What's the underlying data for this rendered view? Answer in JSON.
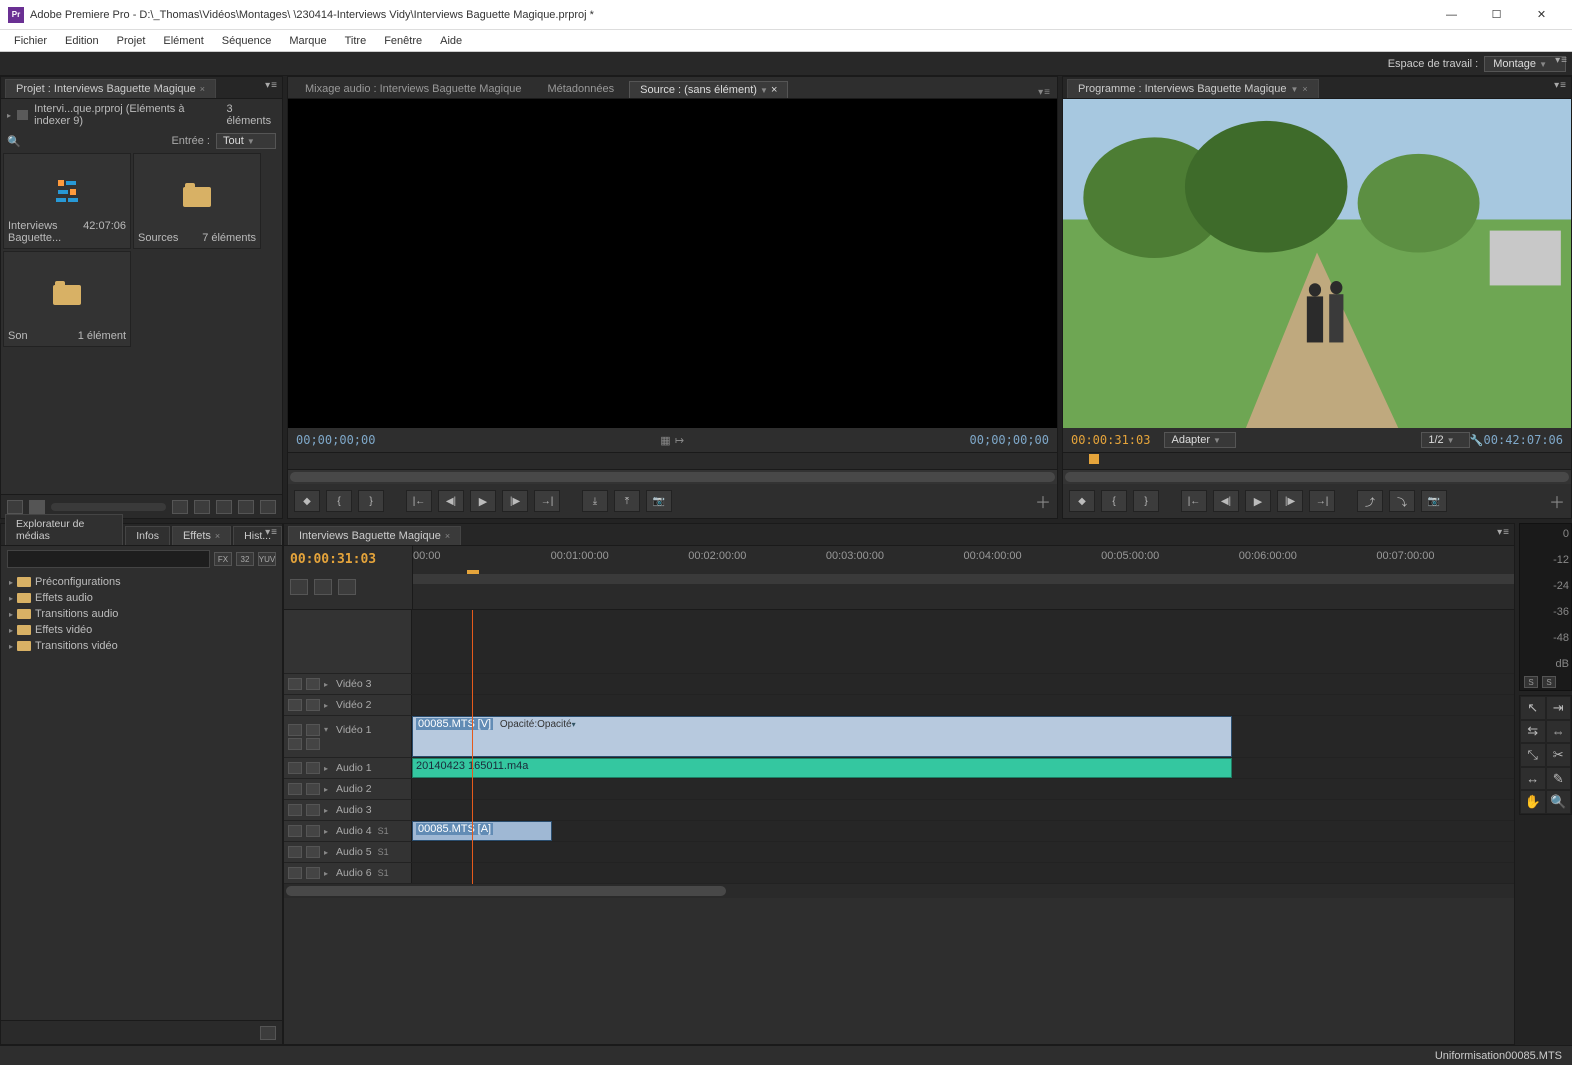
{
  "titlebar": {
    "app_badge": "Pr",
    "title": "Adobe Premiere Pro - D:\\_Thomas\\Vidéos\\Montages\\                       \\230414-Interviews Vidy\\Interviews Baguette Magique.prproj *"
  },
  "menubar": [
    "Fichier",
    "Edition",
    "Projet",
    "Elément",
    "Séquence",
    "Marque",
    "Titre",
    "Fenêtre",
    "Aide"
  ],
  "workspace": {
    "label": "Espace de travail :",
    "value": "Montage"
  },
  "project": {
    "tab": "Projet : Interviews Baguette Magique",
    "path": "Intervi...que.prproj (Eléments à indexer 9)",
    "count": "3 éléments",
    "entry_label": "Entrée :",
    "entry_value": "Tout",
    "items": [
      {
        "name": "Interviews Baguette...",
        "right": "42:07:06",
        "kind": "sequence"
      },
      {
        "name": "Sources",
        "right": "7 éléments",
        "kind": "bin"
      },
      {
        "name": "Son",
        "right": "1 élément",
        "kind": "bin"
      }
    ]
  },
  "source": {
    "tabs": {
      "mix": "Mixage audio : Interviews Baguette Magique",
      "meta": "Métadonnées",
      "src": "Source : (sans élément)"
    },
    "tc_left": "00;00;00;00",
    "tc_right": "00;00;00;00"
  },
  "program": {
    "tab": "Programme : Interviews Baguette Magique",
    "tc_left": "00:00:31:03",
    "fit": "Adapter",
    "ratio": "1/2",
    "tc_right": "00:42:07:06"
  },
  "effects": {
    "tabs": [
      "Explorateur de médias",
      "Infos",
      "Effets",
      "Hist..."
    ],
    "active_index": 2,
    "search_placeholder": "",
    "badges": [
      "FX",
      "32",
      "YUV"
    ],
    "nodes": [
      "Préconfigurations",
      "Effets audio",
      "Transitions audio",
      "Effets vidéo",
      "Transitions vidéo"
    ]
  },
  "timeline": {
    "tab": "Interviews Baguette Magique",
    "tc": "00:00:31:03",
    "ruler": [
      "00:00",
      "00:01:00:00",
      "00:02:00:00",
      "00:03:00:00",
      "00:04:00:00",
      "00:05:00:00",
      "00:06:00:00",
      "00:07:00:00"
    ],
    "tracks": {
      "video": [
        "Vidéo 3",
        "Vidéo 2",
        "Vidéo 1"
      ],
      "audio": [
        "Audio 1",
        "Audio 2",
        "Audio 3",
        "Audio 4",
        "Audio 5",
        "Audio 6"
      ]
    },
    "clips": {
      "v1": {
        "name": "00085.MTS",
        "suffix": "[V]",
        "fx": "Opacité:Opacité"
      },
      "a1": {
        "name": "20140423 165011.m4a"
      },
      "a4": {
        "name": "00085.MTS",
        "suffix": "[A]"
      }
    },
    "target_markers": {
      "a4": "S1",
      "a5": "S1",
      "a6": "S1"
    }
  },
  "meters": {
    "scale": [
      "0",
      "-12",
      "-24",
      "-36",
      "-48",
      "dB"
    ],
    "solo": [
      "S",
      "S"
    ]
  },
  "tools": [
    "select",
    "track-select",
    "ripple",
    "rolling",
    "rate-stretch",
    "razor",
    "slip",
    "slide",
    "pen",
    "hand",
    "zoom"
  ],
  "status": "Uniformisation00085.MTS"
}
